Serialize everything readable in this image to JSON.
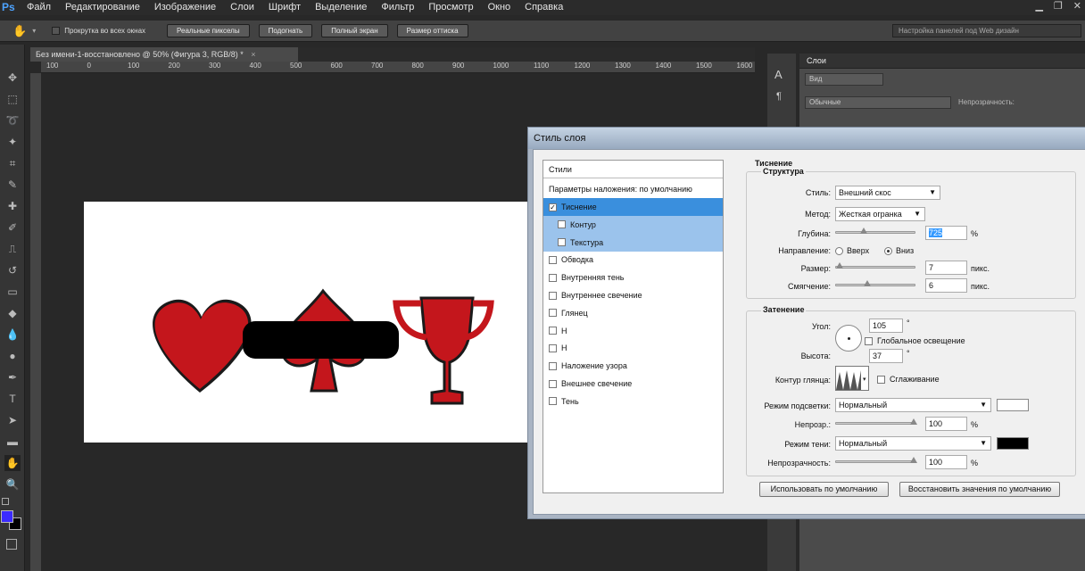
{
  "menubar": {
    "logo": "Ps",
    "items": [
      "Файл",
      "Редактирование",
      "Изображение",
      "Слои",
      "Шрифт",
      "Выделение",
      "Фильтр",
      "Просмотр",
      "Окно",
      "Справка"
    ]
  },
  "options": {
    "scroll_all_label": "Прокрутка во всех окнах",
    "buttons": [
      "Реальные пикселы",
      "Подогнать",
      "Полный экран",
      "Размер оттиска"
    ],
    "workspace": "Настройка панелей под Web дизайн"
  },
  "document": {
    "tab_title": "Без имени-1-восстановлено @ 50% (Фигура 3, RGB/8) *",
    "close": "×",
    "ruler_ticks": [
      "100",
      "0",
      "100",
      "200",
      "300",
      "400",
      "500",
      "600",
      "700",
      "800",
      "900",
      "1000",
      "1100",
      "1200",
      "1300",
      "1400",
      "1500",
      "1600"
    ]
  },
  "colors": {
    "shape_red": "#c4161c",
    "foreground": "#3b2bff",
    "background": "#000000",
    "dialog_selected": "#3a8fdd"
  },
  "layers_panel": {
    "title": "Слои",
    "filter": "Вид",
    "blend": "Обычные",
    "opacity_label": "Непрозрачность:"
  },
  "dialog": {
    "title": "Стиль слоя",
    "styles_header": "Стили",
    "blend_default": "Параметры наложения: по умолчанию",
    "styles": [
      {
        "label": "Тиснение",
        "checked": true,
        "selected": true
      },
      {
        "label": "Контур",
        "checked": false,
        "sub": true
      },
      {
        "label": "Текстура",
        "checked": false,
        "sub": true
      },
      {
        "label": "Обводка",
        "checked": false
      },
      {
        "label": "Внутренняя тень",
        "checked": false
      },
      {
        "label": "Внутреннее свечение",
        "checked": false
      },
      {
        "label": "Глянец",
        "checked": false
      },
      {
        "label": "Н",
        "checked": false
      },
      {
        "label": "Н",
        "checked": false
      },
      {
        "label": "Наложение узора",
        "checked": false
      },
      {
        "label": "Внешнее свечение",
        "checked": false
      },
      {
        "label": "Тень",
        "checked": false
      }
    ],
    "bevel": {
      "title": "Тиснение",
      "structure_title": "Структура",
      "style_label": "Стиль:",
      "style_value": "Внешний скос",
      "method_label": "Метод:",
      "method_value": "Жесткая огранка",
      "depth_label": "Глубина:",
      "depth_value": "725",
      "depth_unit": "%",
      "depth_fraction": 0.35,
      "direction_label": "Направление:",
      "dir_up": "Вверх",
      "dir_down": "Вниз",
      "size_label": "Размер:",
      "size_value": "7",
      "size_unit": "пикс.",
      "size_fraction": 0.05,
      "soften_label": "Смягчение:",
      "soften_value": "6",
      "soften_unit": "пикс.",
      "soften_fraction": 0.4
    },
    "shading": {
      "title": "Затенение",
      "angle_label": "Угол:",
      "angle_value": "105",
      "angle_unit": "°",
      "global_light": "Глобальное освещение",
      "altitude_label": "Высота:",
      "altitude_value": "37",
      "altitude_unit": "°",
      "gloss_label": "Контур глянца:",
      "antialias": "Сглаживание",
      "highlight_label": "Режим подсветки:",
      "highlight_value": "Нормальный",
      "highlight_color": "#ffffff",
      "hl_opacity_label": "Непрозр.:",
      "hl_opacity_value": "100",
      "hl_unit": "%",
      "shadow_label": "Режим тени:",
      "shadow_value": "Нормальный",
      "shadow_color": "#000000",
      "sh_opacity_label": "Непрозрачность:",
      "sh_opacity_value": "100",
      "sh_unit": "%"
    },
    "btn_default": "Использовать по умолчанию",
    "btn_reset": "Восстановить значения по умолчанию"
  }
}
